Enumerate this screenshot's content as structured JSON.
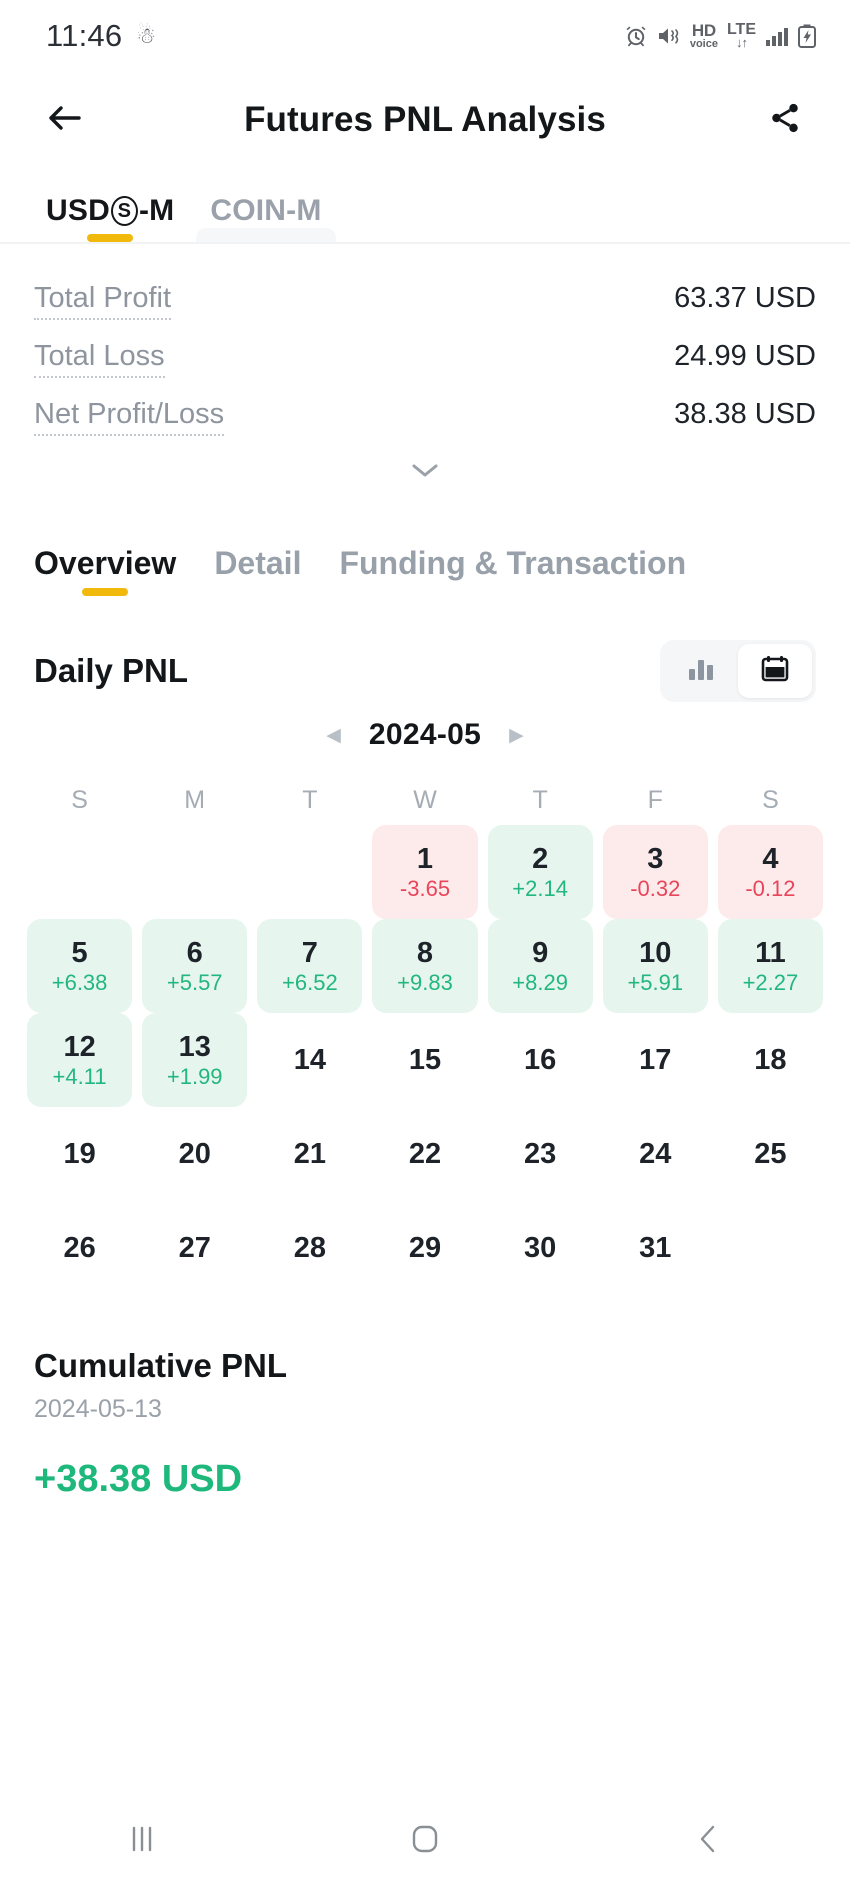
{
  "status_bar": {
    "time": "11:46",
    "left_icons": [
      "snowman-icon"
    ],
    "right_icons": [
      "alarm-icon",
      "mute-vibrate-icon",
      "hd-voice-icon",
      "lte-icon",
      "signal-bars-icon",
      "battery-charging-icon"
    ],
    "hd_label": "HD",
    "voice_label": "voice",
    "lte_label": "LTE"
  },
  "appbar": {
    "title": "Futures PNL Analysis",
    "back_icon": "back-arrow-icon",
    "share_icon": "share-icon"
  },
  "market_tabs": {
    "items": [
      {
        "id": "usds-m",
        "prefix": "USD",
        "badge": "S",
        "suffix": "-M",
        "label": "USDⓈ-M",
        "active": true
      },
      {
        "id": "coin-m",
        "label": "COIN-M",
        "active": false
      }
    ],
    "accent_color": "#f0b90b"
  },
  "summary": {
    "rows": [
      {
        "label": "Total Profit",
        "value": "63.37 USD"
      },
      {
        "label": "Total Loss",
        "value": "24.99 USD"
      },
      {
        "label": "Net Profit/Loss",
        "value": "38.38 USD"
      }
    ],
    "expand_icon": "chevron-down-icon"
  },
  "section_tabs": {
    "items": [
      {
        "id": "overview",
        "label": "Overview",
        "active": true
      },
      {
        "id": "detail",
        "label": "Detail",
        "active": false
      },
      {
        "id": "funding-transaction",
        "label": "Funding & Transaction",
        "active": false
      }
    ]
  },
  "daily_pnl": {
    "title": "Daily PNL",
    "view_toggle": [
      {
        "id": "chart-view",
        "icon": "bar-chart-icon",
        "active": false
      },
      {
        "id": "calendar-view",
        "icon": "calendar-icon",
        "active": true
      }
    ],
    "month": "2024-05",
    "prev_icon": "triangle-left-icon",
    "next_icon": "triangle-right-icon",
    "weekdays": [
      "S",
      "M",
      "T",
      "W",
      "T",
      "F",
      "S"
    ],
    "positive_color": "#23b77f",
    "negative_color": "#e8455b",
    "positive_bg": "#e6f6ee",
    "negative_bg": "#fdeaea",
    "weeks": [
      [
        {
          "day": "",
          "value": "",
          "state": "empty"
        },
        {
          "day": "",
          "value": "",
          "state": "empty"
        },
        {
          "day": "",
          "value": "",
          "state": "empty"
        },
        {
          "day": "1",
          "value": "-3.65",
          "state": "neg"
        },
        {
          "day": "2",
          "value": "+2.14",
          "state": "pos"
        },
        {
          "day": "3",
          "value": "-0.32",
          "state": "neg"
        },
        {
          "day": "4",
          "value": "-0.12",
          "state": "neg"
        }
      ],
      [
        {
          "day": "5",
          "value": "+6.38",
          "state": "pos"
        },
        {
          "day": "6",
          "value": "+5.57",
          "state": "pos"
        },
        {
          "day": "7",
          "value": "+6.52",
          "state": "pos"
        },
        {
          "day": "8",
          "value": "+9.83",
          "state": "pos"
        },
        {
          "day": "9",
          "value": "+8.29",
          "state": "pos"
        },
        {
          "day": "10",
          "value": "+5.91",
          "state": "pos"
        },
        {
          "day": "11",
          "value": "+2.27",
          "state": "pos"
        }
      ],
      [
        {
          "day": "12",
          "value": "+4.11",
          "state": "pos"
        },
        {
          "day": "13",
          "value": "+1.99",
          "state": "pos"
        },
        {
          "day": "14",
          "value": "",
          "state": "plain"
        },
        {
          "day": "15",
          "value": "",
          "state": "plain"
        },
        {
          "day": "16",
          "value": "",
          "state": "plain"
        },
        {
          "day": "17",
          "value": "",
          "state": "plain"
        },
        {
          "day": "18",
          "value": "",
          "state": "plain"
        }
      ],
      [
        {
          "day": "19",
          "value": "",
          "state": "plain"
        },
        {
          "day": "20",
          "value": "",
          "state": "plain"
        },
        {
          "day": "21",
          "value": "",
          "state": "plain"
        },
        {
          "day": "22",
          "value": "",
          "state": "plain"
        },
        {
          "day": "23",
          "value": "",
          "state": "plain"
        },
        {
          "day": "24",
          "value": "",
          "state": "plain"
        },
        {
          "day": "25",
          "value": "",
          "state": "plain"
        }
      ],
      [
        {
          "day": "26",
          "value": "",
          "state": "plain"
        },
        {
          "day": "27",
          "value": "",
          "state": "plain"
        },
        {
          "day": "28",
          "value": "",
          "state": "plain"
        },
        {
          "day": "29",
          "value": "",
          "state": "plain"
        },
        {
          "day": "30",
          "value": "",
          "state": "plain"
        },
        {
          "day": "31",
          "value": "",
          "state": "plain"
        },
        {
          "day": "",
          "value": "",
          "state": "empty"
        }
      ]
    ]
  },
  "cumulative_pnl": {
    "title": "Cumulative PNL",
    "date": "2024-05-13",
    "value": "+38.38 USD"
  },
  "android_nav": {
    "items": [
      {
        "id": "recents",
        "icon": "recents-icon"
      },
      {
        "id": "home",
        "icon": "home-icon"
      },
      {
        "id": "back",
        "icon": "back-chevron-icon"
      }
    ]
  }
}
